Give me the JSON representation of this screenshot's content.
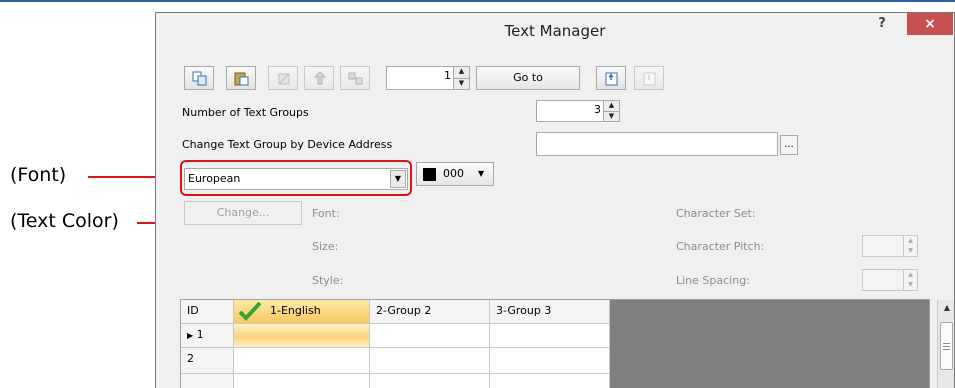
{
  "window": {
    "title": "Text Manager",
    "help_label": "?",
    "close_label": "×"
  },
  "callouts": {
    "font": "(Font)",
    "text_color": "(Text Color)"
  },
  "toolbar": {
    "buttons": [
      "copy-icon",
      "paste-icon",
      "clear-icon",
      "move-icon",
      "replace-icon"
    ],
    "goto_value": "1",
    "goto_label": "Go to",
    "export_icon": "export-icon",
    "import_icon": "import-icon"
  },
  "form": {
    "num_groups_label": "Number of Text Groups",
    "num_groups_value": "3",
    "device_address_label": "Change Text Group by Device Address",
    "device_address_value": "",
    "browse_label": "...",
    "font_value": "European",
    "color_value": "000",
    "change_label": "Change...",
    "font_label": "Font:",
    "size_label": "Size:",
    "style_label": "Style:",
    "charset_label": "Character Set:",
    "char_pitch_label": "Character Pitch:",
    "line_spacing_label": "Line Spacing:"
  },
  "grid": {
    "columns": [
      "ID",
      "1-English",
      "2-Group 2",
      "3-Group 3"
    ],
    "rows": [
      {
        "id": "1",
        "cells": [
          "",
          "",
          ""
        ]
      },
      {
        "id": "2",
        "cells": [
          "",
          "",
          ""
        ]
      }
    ],
    "selected_marker": "▶"
  },
  "colors": {
    "callout_line": "#d9141b",
    "close_button": "#c75050",
    "checkmark": "#3aa335",
    "selected_column": "#f9c95e"
  }
}
